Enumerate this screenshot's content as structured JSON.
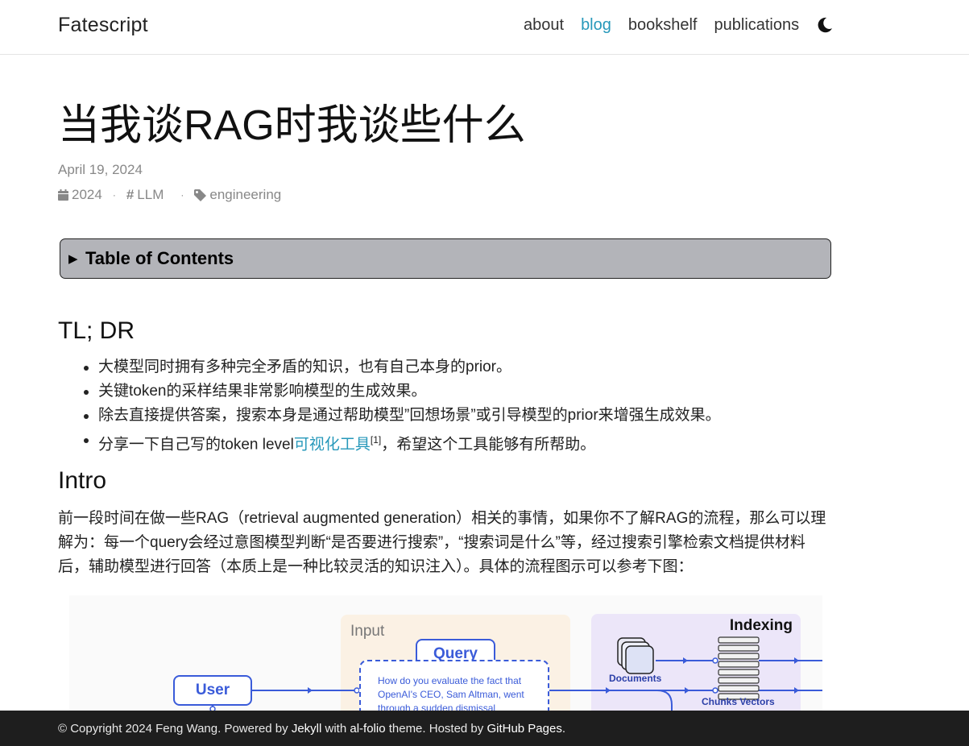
{
  "nav": {
    "brand": "Fatescript",
    "links": [
      "about",
      "blog",
      "bookshelf",
      "publications"
    ],
    "active": "blog",
    "theme_icon": "moon-icon"
  },
  "post": {
    "title": "当我谈RAG时我谈些什么",
    "date": "April 19, 2024",
    "meta": {
      "year": "2024",
      "category": "LLM",
      "tag": "engineering"
    }
  },
  "toc": {
    "arrow": "▶",
    "label": "Table of Contents"
  },
  "sections": {
    "tldr": {
      "heading": "TL; DR",
      "bullets": [
        "大模型同时拥有多种完全矛盾的知识，也有自己本身的prior。",
        "关键token的采样结果非常影响模型的生成效果。",
        "除去直接提供答案，搜索本身是通过帮助模型”回想场景”或引导模型的prior来增强生成效果。"
      ],
      "last_bullet": {
        "prefix": "分享一下自己写的token level",
        "link": "可视化工具",
        "ref": "[1]",
        "suffix": "，希望这个工具能够有所帮助。"
      }
    },
    "intro": {
      "heading": "Intro",
      "paragraph": "前一段时间在做一些RAG（retrieval augmented generation）相关的事情，如果你不了解RAG的流程，那么可以理解为：每一个query会经过意图模型判断“是否要进行搜索”，“搜索词是什么”等，经过搜索引擎检索文档提供材料后，辅助模型进行回答（本质上是一种比较灵活的知识注入）。具体的流程图示可以参考下图："
    }
  },
  "figure": {
    "input_label": "Input",
    "query_label": "Query",
    "query_text": "How do you evaluate the fact that OpenAI's CEO, Sam Altman, went through a sudden dismissal",
    "user_label": "User",
    "indexing_label": "Indexing",
    "documents_label": "Documents",
    "chunks_vectors_label": "Chunks Vectors",
    "accent_color": "#3a5bd9"
  },
  "footer": {
    "copyright": "© Copyright 2024 Feng Wang. Powered by ",
    "jekyll": "Jekyll",
    "with": " with ",
    "alfolio": "al-folio",
    "theme": " theme. Hosted by ",
    "github": "GitHub Pages",
    "end": "."
  },
  "colors": {
    "link": "#2698ba",
    "toc_bg": "#b3b4b9",
    "footer_bg": "#1e1e1e"
  }
}
